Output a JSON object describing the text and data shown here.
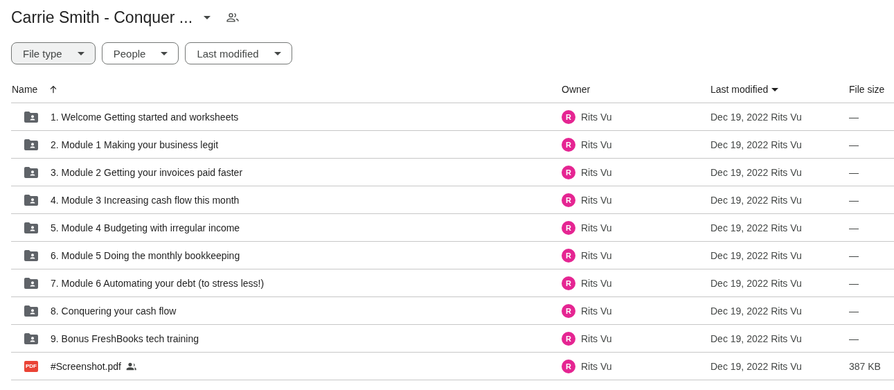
{
  "header": {
    "title": "Carrie Smith - Conquer ...",
    "shared": true
  },
  "filters": [
    {
      "label": "File type",
      "selected": true
    },
    {
      "label": "People",
      "selected": false
    },
    {
      "label": "Last modified",
      "selected": false
    }
  ],
  "table": {
    "columns": [
      {
        "label": "Name",
        "sorted": true,
        "descending": false
      },
      {
        "label": "Owner",
        "sorted": false
      },
      {
        "label": "Last modified",
        "sorted": true,
        "descending": true
      },
      {
        "label": "File size",
        "sorted": false
      }
    ],
    "rows": [
      {
        "kind": "folder",
        "name": "1. Welcome Getting started and worksheets",
        "shared": false,
        "owner_initial": "R",
        "color": "#e52592",
        "owner": "Rits Vu",
        "modified": "Dec 19, 2022 Rits Vu",
        "size": "—"
      },
      {
        "kind": "folder",
        "name": "2. Module 1 Making your business legit",
        "shared": false,
        "owner_initial": "R",
        "color": "#e52592",
        "owner": "Rits Vu",
        "modified": "Dec 19, 2022 Rits Vu",
        "size": "—"
      },
      {
        "kind": "folder",
        "name": "3. Module 2 Getting your invoices paid faster",
        "shared": false,
        "owner_initial": "R",
        "color": "#e52592",
        "owner": "Rits Vu",
        "modified": "Dec 19, 2022 Rits Vu",
        "size": "—"
      },
      {
        "kind": "folder",
        "name": "4. Module 3 Increasing cash flow this month",
        "shared": false,
        "owner_initial": "R",
        "color": "#e52592",
        "owner": "Rits Vu",
        "modified": "Dec 19, 2022 Rits Vu",
        "size": "—"
      },
      {
        "kind": "folder",
        "name": "5. Module 4 Budgeting with irregular income",
        "shared": false,
        "owner_initial": "R",
        "color": "#e52592",
        "owner": "Rits Vu",
        "modified": "Dec 19, 2022 Rits Vu",
        "size": "—"
      },
      {
        "kind": "folder",
        "name": "6. Module 5 Doing the monthly bookkeeping",
        "shared": false,
        "owner_initial": "R",
        "color": "#e52592",
        "owner": "Rits Vu",
        "modified": "Dec 19, 2022 Rits Vu",
        "size": "—"
      },
      {
        "kind": "folder",
        "name": "7. Module 6 Automating your debt (to stress less!)",
        "shared": false,
        "owner_initial": "R",
        "color": "#e52592",
        "owner": "Rits Vu",
        "modified": "Dec 19, 2022 Rits Vu",
        "size": "—"
      },
      {
        "kind": "folder",
        "name": "8. Conquering your cash flow",
        "shared": false,
        "owner_initial": "R",
        "color": "#e52592",
        "owner": "Rits Vu",
        "modified": "Dec 19, 2022 Rits Vu",
        "size": "—"
      },
      {
        "kind": "folder",
        "name": "9. Bonus FreshBooks tech training",
        "shared": false,
        "owner_initial": "R",
        "color": "#e52592",
        "owner": "Rits Vu",
        "modified": "Dec 19, 2022 Rits Vu",
        "size": "—"
      },
      {
        "kind": "pdf",
        "icon_text": "PDF",
        "name": "#Screenshot.pdf",
        "shared": true,
        "owner_initial": "R",
        "color": "#e52592",
        "owner": "Rits Vu",
        "modified": "Dec 19, 2022 Rits Vu",
        "size": "387 KB"
      }
    ]
  }
}
